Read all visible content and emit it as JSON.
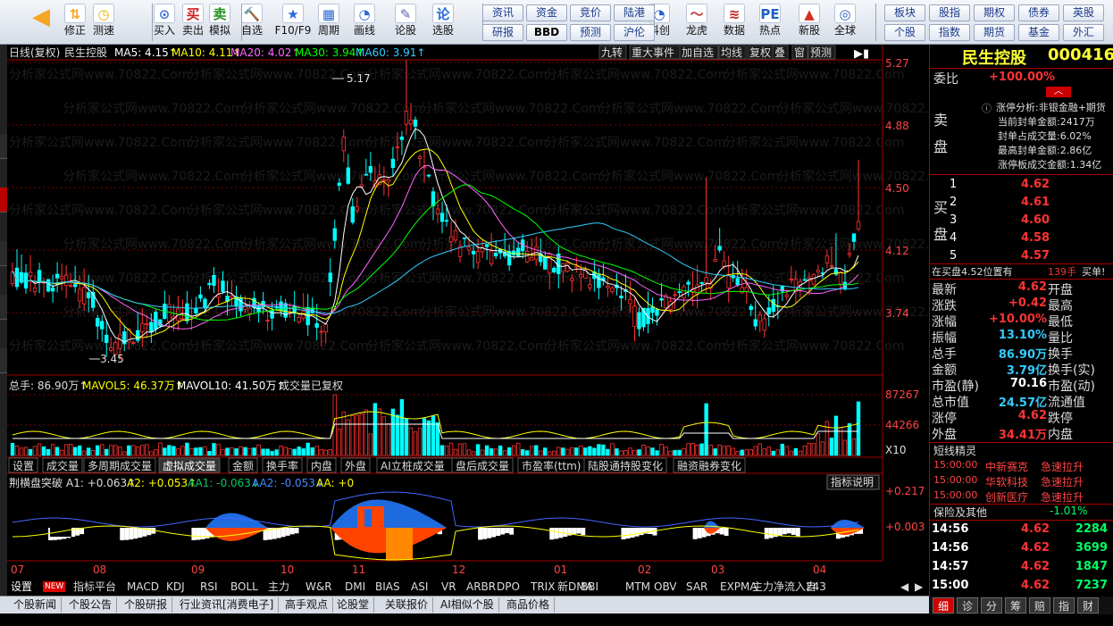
{
  "toolbar": {
    "buttons": [
      {
        "label": "",
        "icon": "back-arrow-icon"
      },
      {
        "label": "修正",
        "icon": "up-down-arrow-icon"
      },
      {
        "label": "测速",
        "icon": "clock-icon"
      },
      {
        "label": "买入",
        "icon": "buy-icon"
      },
      {
        "label": "卖出",
        "icon": "sell-icon"
      },
      {
        "label": "模拟",
        "icon": "hammer-icon"
      },
      {
        "label": "自选",
        "icon": "star-icon"
      },
      {
        "label": "F10/F9",
        "icon": "f10-icon"
      },
      {
        "label": "周期",
        "icon": "period-icon"
      },
      {
        "label": "画线",
        "icon": "pen-icon"
      },
      {
        "label": "论股",
        "icon": "discuss-icon"
      },
      {
        "label": "选股",
        "icon": "select-stock-icon"
      },
      {
        "label": "科创",
        "icon": "star-market-icon"
      },
      {
        "label": "龙虎",
        "icon": "dragon-tiger-icon"
      },
      {
        "label": "数据",
        "icon": "pe-icon"
      },
      {
        "label": "热点",
        "icon": "hot-icon"
      },
      {
        "label": "新股",
        "icon": "ipo-icon"
      },
      {
        "label": "全球",
        "icon": "globe-icon"
      }
    ],
    "small_buttons": [
      [
        "资讯",
        "资金",
        "竞价",
        "陆港"
      ],
      [
        "研报",
        "BBD",
        "预测",
        "沪伦"
      ],
      [
        "板块",
        "股指",
        "期权",
        "债券",
        "英股"
      ],
      [
        "个股",
        "指数",
        "期货",
        "基金",
        "外汇"
      ]
    ]
  },
  "chart": {
    "title": "日线(复权)",
    "stock_name": "民生控股",
    "ma_labels": [
      {
        "text": "MA5: 4.15↑",
        "color": "#ffffff"
      },
      {
        "text": "MA10: 4.11↑",
        "color": "#ffff00"
      },
      {
        "text": "MA20: 4.02↑",
        "color": "#ff66ff"
      },
      {
        "text": "MA30: 3.94↑",
        "color": "#00ff00"
      },
      {
        "text": "MA60: 3.91↑",
        "color": "#33ccff"
      }
    ],
    "top_tags": [
      "九转",
      "重大事件",
      "加自选",
      "均线",
      "复权",
      "叠",
      "窗",
      "预测"
    ],
    "price_axis": [
      "5.27",
      "4.88",
      "4.50",
      "4.12",
      "3.74"
    ],
    "high_marker": "5.17",
    "low_marker": "3.45",
    "vol_legend": {
      "total": "总手: 86.90万↑",
      "mavol5": "MAVOL5: 46.37万↑",
      "mavol10": "MAVOL10: 41.50万↑",
      "note": "成交量已复权"
    },
    "vol_axis": [
      "87267",
      "44266",
      "X10"
    ],
    "sub_tabs": [
      "设置",
      "成交量",
      "多周期成交量",
      "虚拟成交量",
      "金额",
      "换手率",
      "内盘",
      "外盘",
      "AI立桩成交量",
      "盘后成交量",
      "市盈率(ttm)",
      "陆股通持股变化",
      "融资融券变化"
    ],
    "indicator_legend": {
      "name": "荆横盘突破",
      "a1": "A1: +0.063↑",
      "a2": "A2: +0.053↑",
      "aa1": "AA1: -0.063↓",
      "aa2": "AA2: -0.053↓",
      "aa": "AA: +0"
    },
    "indicator_btn": "指标说明",
    "indicator_axis": [
      "+0.217",
      "+0.003"
    ],
    "months": [
      "07",
      "08",
      "09",
      "10",
      "11",
      "12",
      "01",
      "02",
      "03",
      "04"
    ],
    "watermark": "分析家公式网www.70822.Com"
  },
  "bottom_tabs": [
    "设置",
    "NEW",
    "指标平台",
    "MACD",
    "KDJ",
    "RSI",
    "BOLL",
    "主力",
    "W&R",
    "DMI",
    "BIAS",
    "ASI",
    "VR",
    "ARBR",
    "DPO",
    "TRIX",
    "新DMA",
    "BBI",
    "MTM",
    "OBV",
    "SAR",
    "EXPMA",
    "主力净流入自",
    "243"
  ],
  "news_tabs": [
    "个股新闻",
    "个股公告",
    "个股研报",
    "行业资讯[消费电子]",
    "高手观点",
    "论股堂",
    "关联报价",
    "AI相似个股",
    "商品价格"
  ],
  "quote": {
    "name": "民生控股",
    "code": "000416",
    "weibi_label": "委比",
    "weibi_value": "+100.00%",
    "zt_title": "涨停分析:非银金融+期货",
    "zt_rows": [
      "当前封单金额:2417万",
      "封单占成交量:6.02%",
      "最高封单金额:2.86亿",
      "涨停板成交金额:1.34亿"
    ],
    "sell_label": "卖盘",
    "buy_label": "买盘",
    "buy_book": [
      {
        "lv": "1",
        "p": "4.62"
      },
      {
        "lv": "2",
        "p": "4.61"
      },
      {
        "lv": "3",
        "p": "4.60"
      },
      {
        "lv": "4",
        "p": "4.58"
      },
      {
        "lv": "5",
        "p": "4.57"
      }
    ],
    "buy_note": "在买盘4.52位置有",
    "buy_note_vol": "139手",
    "buy_note_tag": "买单!",
    "stats": [
      {
        "k": "最新",
        "v": "4.62",
        "k2": "开盘",
        "c": "#ff3333"
      },
      {
        "k": "涨跌",
        "v": "+0.42",
        "k2": "最高",
        "c": "#ff3333"
      },
      {
        "k": "涨幅",
        "v": "+10.00%",
        "k2": "最低",
        "c": "#ff3333"
      },
      {
        "k": "振幅",
        "v": "13.10%",
        "k2": "量比",
        "c": "#33ccff"
      },
      {
        "k": "总手",
        "v": "86.90万",
        "k2": "换手",
        "c": "#33ccff"
      },
      {
        "k": "金额",
        "v": "3.79亿",
        "k2": "换手(实)",
        "c": "#33ccff"
      },
      {
        "k": "市盈(静)",
        "v": "70.16",
        "k2": "市盈(动)",
        "c": "#ffffff"
      },
      {
        "k": "总市值",
        "v": "24.57亿",
        "k2": "流通值",
        "c": "#33ccff"
      },
      {
        "k": "涨停",
        "v": "4.62",
        "k2": "跌停",
        "c": "#ff3333"
      },
      {
        "k": "外盘",
        "v": "34.41万",
        "k2": "内盘",
        "c": "#ff3333"
      }
    ],
    "short_title": "短线精灵",
    "short_rows": [
      {
        "t": "15:00:00",
        "n": "中新赛克",
        "a": "急速拉升"
      },
      {
        "t": "15:00:00",
        "n": "华软科技",
        "a": "急速拉升"
      },
      {
        "t": "15:00:00",
        "n": "创新医疗",
        "a": "急速拉升"
      }
    ],
    "sector_name": "保险及其他",
    "sector_pct": "-1.01%",
    "ticks": [
      {
        "t": "14:56",
        "p": "4.62",
        "v": "2284"
      },
      {
        "t": "14:56",
        "p": "4.62",
        "v": "3699"
      },
      {
        "t": "14:57",
        "p": "4.62",
        "v": "1847"
      },
      {
        "t": "15:00",
        "p": "4.62",
        "v": "7237"
      }
    ],
    "right_tabs": [
      "细",
      "诊",
      "分",
      "筹",
      "赔",
      "指",
      "财"
    ]
  }
}
